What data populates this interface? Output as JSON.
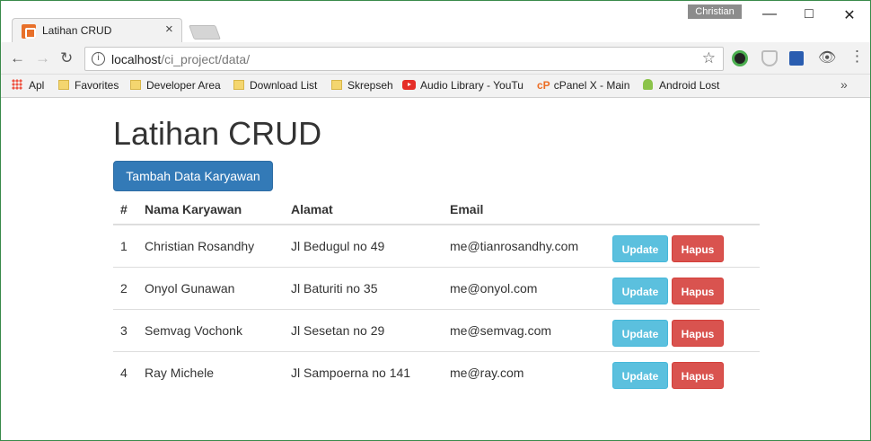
{
  "browser": {
    "tab_title": "Latihan CRUD",
    "profile": "Christian",
    "url_host": "localhost",
    "url_path": "/ci_project/data/",
    "bookmarks": [
      {
        "label": "Apl",
        "icon": "apps-icon"
      },
      {
        "label": "Favorites",
        "icon": "folder-icon"
      },
      {
        "label": "Developer Area",
        "icon": "folder-icon"
      },
      {
        "label": "Download List",
        "icon": "folder-icon"
      },
      {
        "label": "Skrepseh",
        "icon": "folder-icon"
      },
      {
        "label": "Audio Library - YouTu",
        "icon": "youtube-icon"
      },
      {
        "label": "cPanel X - Main",
        "icon": "cpanel-icon"
      },
      {
        "label": "Android Lost",
        "icon": "android-icon"
      }
    ]
  },
  "page": {
    "title": "Latihan CRUD",
    "add_button": "Tambah Data Karyawan",
    "columns": [
      "#",
      "Nama Karyawan",
      "Alamat",
      "Email"
    ],
    "rows": [
      {
        "no": "1",
        "name": "Christian Rosandhy",
        "address": "Jl Bedugul no 49",
        "email": "me@tianrosandhy.com"
      },
      {
        "no": "2",
        "name": "Onyol Gunawan",
        "address": "Jl Baturiti no 35",
        "email": "me@onyol.com"
      },
      {
        "no": "3",
        "name": "Semvag Vochonk",
        "address": "Jl Sesetan no 29",
        "email": "me@semvag.com"
      },
      {
        "no": "4",
        "name": "Ray Michele",
        "address": "Jl Sampoerna no 141",
        "email": "me@ray.com"
      }
    ],
    "update_label": "Update",
    "delete_label": "Hapus"
  }
}
